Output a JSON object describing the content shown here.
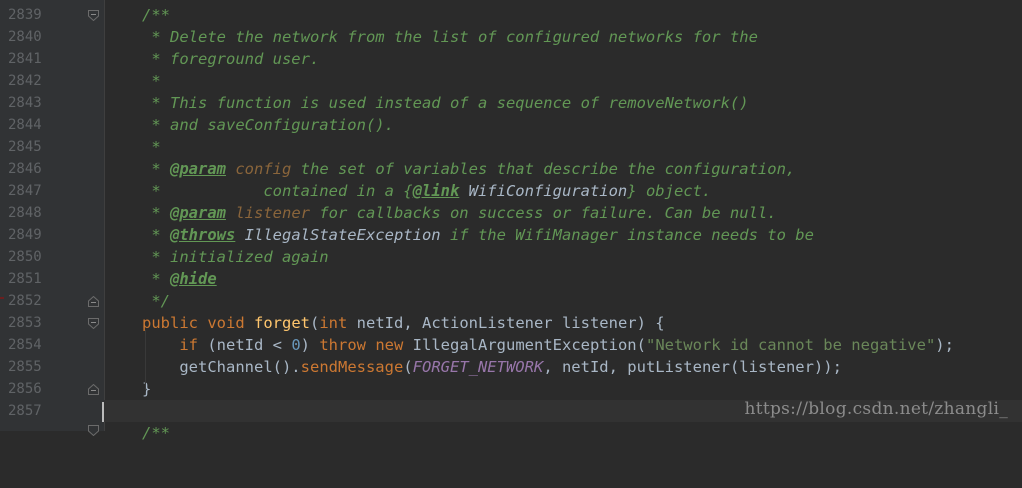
{
  "editor": {
    "gutter": {
      "line_numbers": [
        "2839",
        "2840",
        "2841",
        "2842",
        "2843",
        "2844",
        "2845",
        "2846",
        "2847",
        "2848",
        "2849",
        "2850",
        "2851",
        "2852",
        "2853",
        "2854",
        "2855",
        "2856",
        "2857"
      ]
    },
    "code": {
      "l2839": "/**",
      "l2840": " * Delete the network from the list of configured networks for the",
      "l2841": " * foreground user.",
      "l2842": " *",
      "l2843": " * This function is used instead of a sequence of removeNetwork()",
      "l2844": " * and saveConfiguration().",
      "l2845": " *",
      "l2846": {
        "star": " * ",
        "tag": "@param",
        "pname": " config",
        "rest": " the set of variables that describe the configuration,"
      },
      "l2847": {
        "pre": " *           contained in a {",
        "tag": "@link",
        "ref": " WifiConfiguration",
        "post": "} object."
      },
      "l2848": {
        "star": " * ",
        "tag": "@param",
        "pname": " listener",
        "rest": " for callbacks on success or failure. Can be null."
      },
      "l2849": {
        "star": " * ",
        "tag": "@throws",
        "ref": " IllegalStateException",
        "rest": " if the WifiManager instance needs to be"
      },
      "l2850": " * initialized again",
      "l2851": {
        "star": " * ",
        "tag": "@hide"
      },
      "l2852": " */",
      "l2853": {
        "kw1": "public",
        "kw2": " void ",
        "method": "forget",
        "p1": "(",
        "type1": "int",
        "a1": " netId, ActionListener listener) {"
      },
      "l2854": {
        "indent": "    ",
        "kw_if": "if",
        "a1": " (netId < ",
        "num": "0",
        "a2": ") ",
        "kw_throw": "throw",
        "kw_new": " new",
        "a3": " IllegalArgumentException(",
        "str": "\"Network id cannot be negative\"",
        "a4": ");"
      },
      "l2855": {
        "indent": "    ",
        "a1": "getChannel().",
        "call": "sendMessage",
        "a2": "(",
        "const": "FORGET_NETWORK",
        "a3": ", netId, putListener(listener));"
      },
      "l2856": "}",
      "l2858": "/**"
    },
    "watermark": "https://blog.csdn.net/zhangli_"
  }
}
